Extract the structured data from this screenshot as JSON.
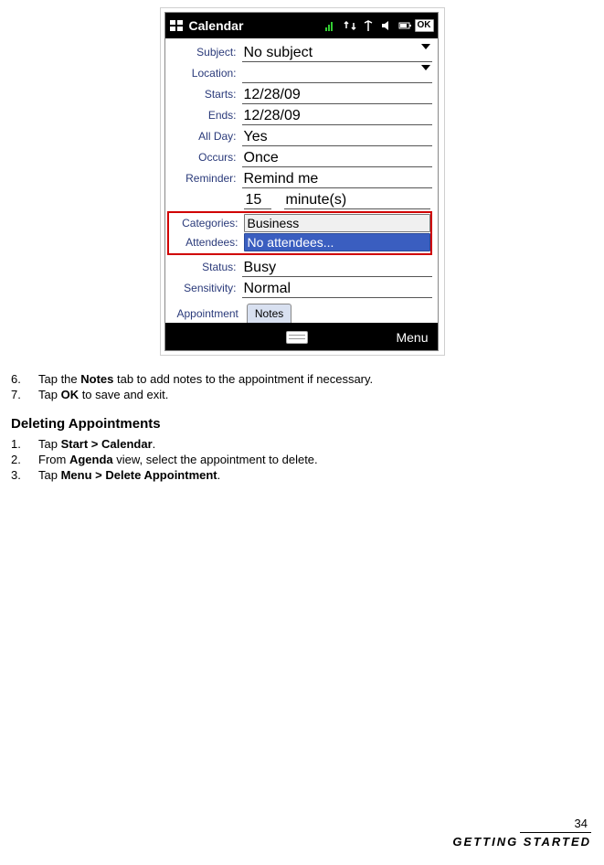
{
  "titlebar": {
    "app_title": "Calendar",
    "ok_label": "OK"
  },
  "form": {
    "subject": {
      "label": "Subject:",
      "value": "No subject"
    },
    "location": {
      "label": "Location:",
      "value": ""
    },
    "starts": {
      "label": "Starts:",
      "value": "12/28/09"
    },
    "ends": {
      "label": "Ends:",
      "value": "12/28/09"
    },
    "all_day": {
      "label": "All Day:",
      "value": "Yes"
    },
    "occurs": {
      "label": "Occurs:",
      "value": "Once"
    },
    "reminder": {
      "label": "Reminder:",
      "value": "Remind me",
      "num": "15",
      "unit": "minute(s)"
    },
    "categories": {
      "label": "Categories:",
      "value": "Business"
    },
    "attendees": {
      "label": "Attendees:",
      "value": "No attendees..."
    },
    "status": {
      "label": "Status:",
      "value": "Busy"
    },
    "sensitivity": {
      "label": "Sensitivity:",
      "value": "Normal"
    }
  },
  "tabs": {
    "appointment": "Appointment",
    "notes": "Notes"
  },
  "bottombar": {
    "menu": "Menu"
  },
  "doc": {
    "step6_num": "6.",
    "step6_a": "Tap the ",
    "step6_b": "Notes",
    "step6_c": " tab to add notes to the appointment if necessary.",
    "step7_num": "7.",
    "step7_a": "Tap ",
    "step7_b": "OK",
    "step7_c": " to save and exit.",
    "heading": "Deleting Appointments",
    "del1_num": "1.",
    "del1_a": "Tap ",
    "del1_b": "Start > Calendar",
    "del1_c": ".",
    "del2_num": "2.",
    "del2_a": "From ",
    "del2_b": "Agenda",
    "del2_c": " view, select the appointment to delete.",
    "del3_num": "3.",
    "del3_a": "Tap ",
    "del3_b": "Menu > Delete Appointment",
    "del3_c": "."
  },
  "footer": {
    "page": "34",
    "section": "Getting Started"
  }
}
